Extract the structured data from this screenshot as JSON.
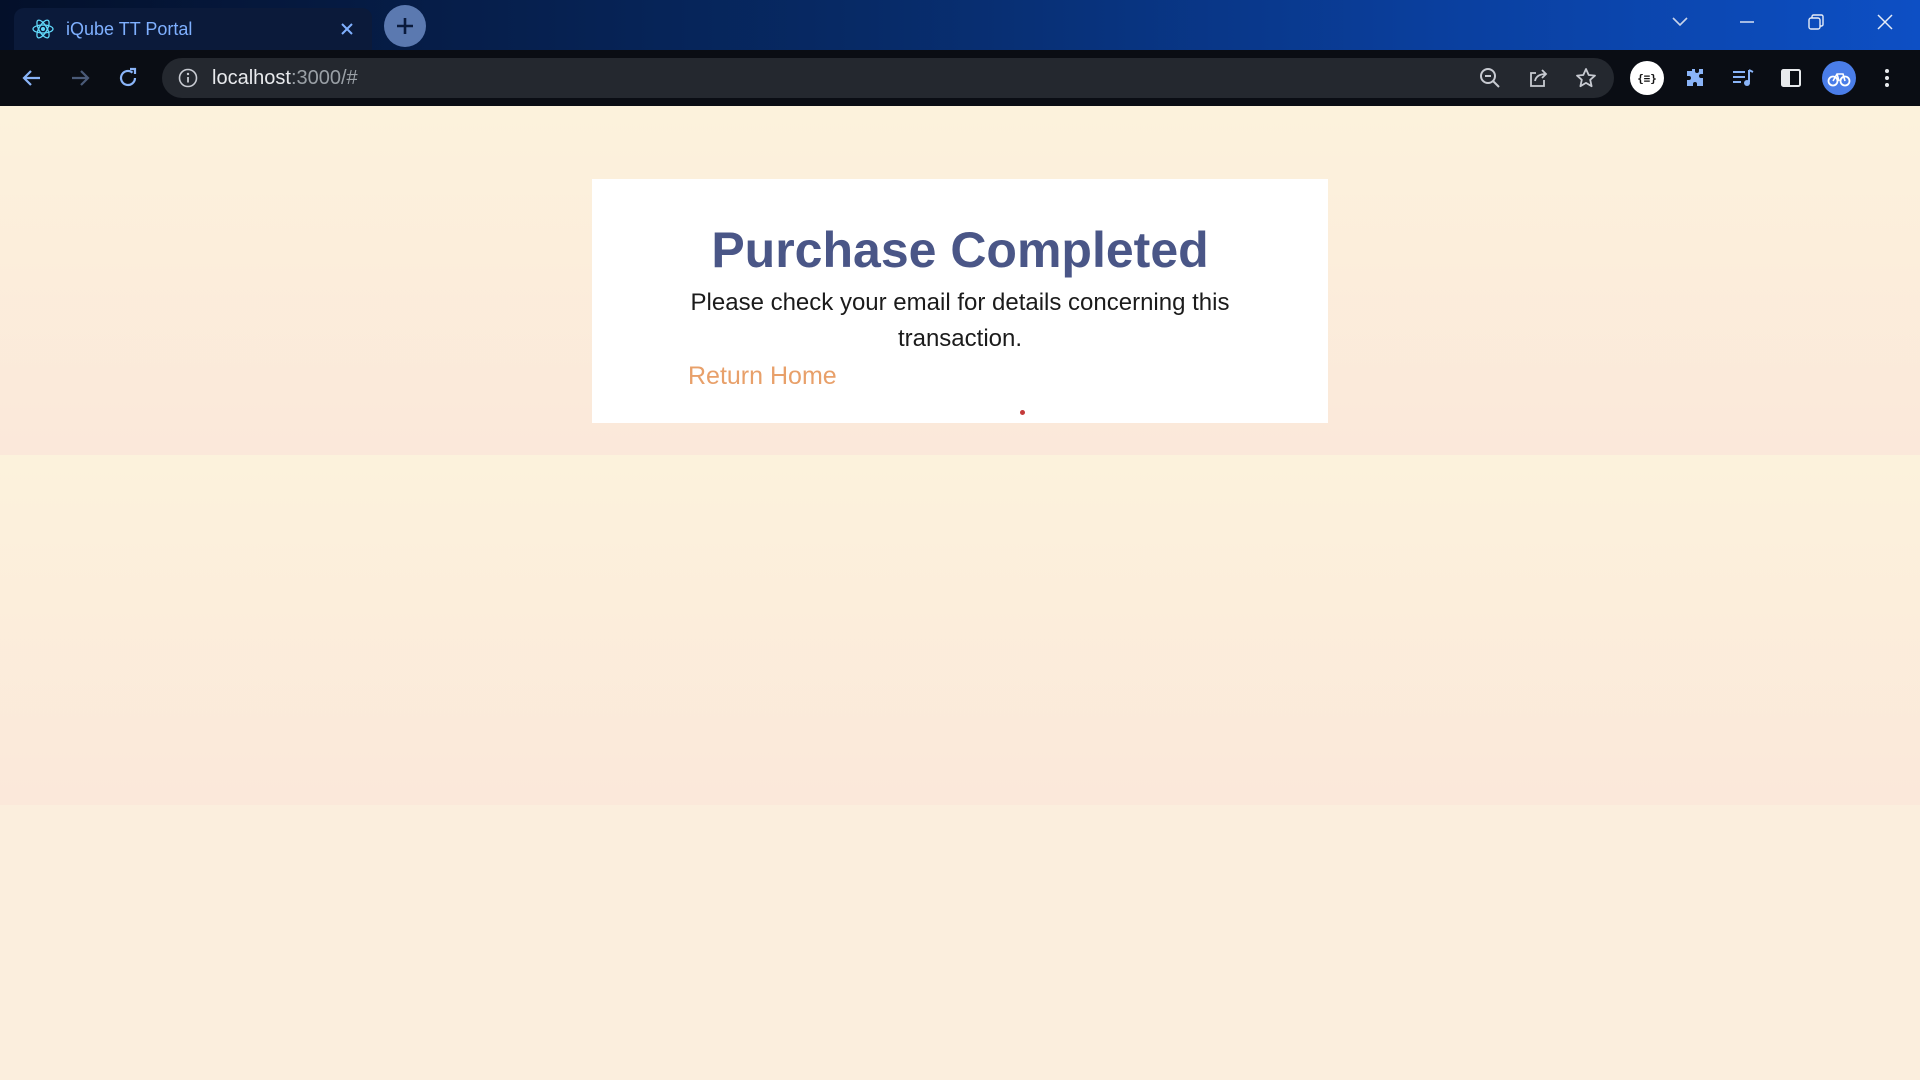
{
  "browser": {
    "tab": {
      "title": "iQube TT Portal",
      "favicon": "react-atom-icon"
    },
    "address_bar": {
      "host": "localhost",
      "rest": ":3000/#"
    },
    "icons": {
      "back": "arrow-left-icon",
      "forward": "arrow-right-icon",
      "reload": "reload-icon",
      "zoom": "zoom-out-icon",
      "share": "share-icon",
      "bookmark": "star-icon",
      "json_extension": "json-viewer-extension-icon",
      "extensions": "puzzle-icon",
      "media": "media-queue-icon",
      "side_panel": "side-panel-icon",
      "profile": "profile-avatar",
      "menu": "kebab-menu-icon"
    },
    "json_extension_label": "{≡}"
  },
  "page": {
    "title": "Purchase Completed",
    "message": "Please check your email for details concerning this transaction.",
    "return_link": "Return Home"
  },
  "colors": {
    "title": "#4a5687",
    "link": "#e8a06a",
    "background": "#fbeedd",
    "card": "#ffffff"
  }
}
